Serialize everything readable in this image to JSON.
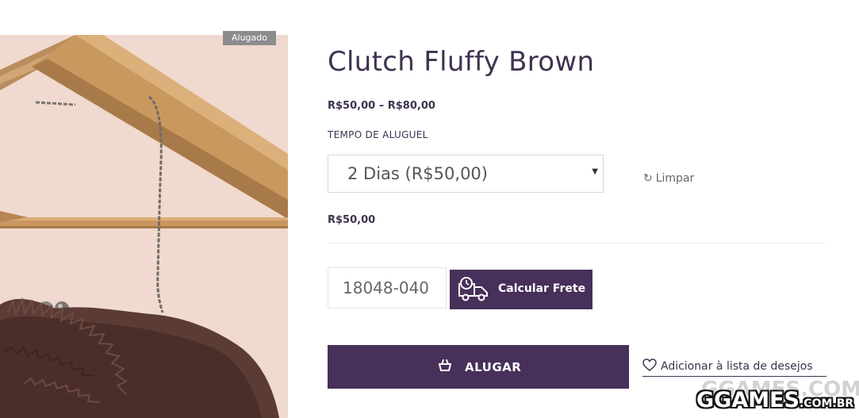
{
  "product": {
    "badge": "Alugado",
    "title": "Clutch Fluffy Brown",
    "price_range": "R$50,00 – R$80,00",
    "variation_price": "R$50,00"
  },
  "rental": {
    "attribute_label": "TEMPO DE ALUGUEL",
    "selected_option": "2 Dias (R$50,00)",
    "reset_label": "Limpar"
  },
  "shipping": {
    "cep_value": "18048-040",
    "calc_label": "Calcular Frete"
  },
  "cart": {
    "rent_label": "ALUGAR",
    "wishlist_label": "Adicionar à lista de desejos"
  },
  "watermark": {
    "brand": "GGAMES",
    "tld": ".COM.BR"
  },
  "colors": {
    "brand_purple": "#47305a",
    "title_text": "#3f3250",
    "badge_gray": "#8c8c8c",
    "image_background": "#f0d9ce"
  },
  "icons": {
    "reset": "refresh-icon",
    "shipping": "truck-clock-icon",
    "rent": "basket-icon",
    "wishlist": "heart-outline-icon",
    "select": "caret-down-icon"
  }
}
